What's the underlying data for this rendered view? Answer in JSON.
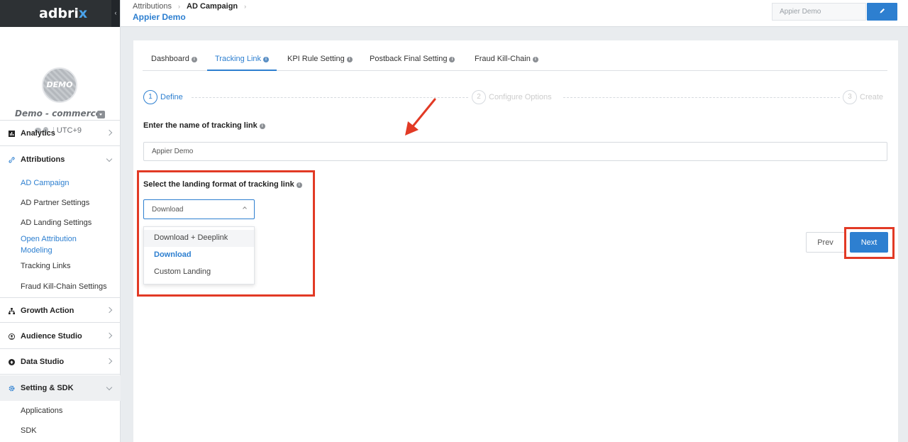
{
  "brand": {
    "logo_main": "adbri",
    "logo_accent": "x"
  },
  "profile": {
    "avatar_text": "DEMO",
    "org_name": "Demo - commerce",
    "timezone": "UTC+9"
  },
  "sidebar": {
    "sections": {
      "analytics": "Analytics",
      "attributions": "Attributions",
      "growth_action": "Growth Action",
      "audience_studio": "Audience Studio",
      "data_studio": "Data Studio",
      "setting_sdk": "Setting & SDK"
    },
    "attribution_items": [
      "AD Campaign",
      "AD Partner Settings",
      "AD Landing Settings",
      "Open Attribution",
      "Modeling",
      "Tracking Links",
      "Fraud Kill-Chain Settings"
    ],
    "setting_items": [
      "Applications",
      "SDK"
    ]
  },
  "header": {
    "breadcrumb": [
      "Attributions",
      "AD Campaign"
    ],
    "subtitle": "Appier Demo",
    "name_value": "Appier Demo"
  },
  "tabs": [
    "Dashboard",
    "Tracking Link",
    "KPI Rule Setting",
    "Postback Final Setting",
    "Fraud Kill-Chain"
  ],
  "steps": [
    {
      "num": "1",
      "label": "Define"
    },
    {
      "num": "2",
      "label": "Configure Options"
    },
    {
      "num": "3",
      "label": "Create"
    }
  ],
  "form": {
    "name_label": "Enter the name of tracking link",
    "name_value": "Appier Demo",
    "landing_label": "Select the landing format of tracking link",
    "landing_selected": "Download",
    "landing_options": [
      "Download + Deeplink",
      "Download",
      "Custom Landing"
    ]
  },
  "buttons": {
    "prev": "Prev",
    "next": "Next"
  },
  "colors": {
    "accent": "#2d7fd0",
    "annotation": "#e23a25",
    "sidebar_dark": "#2d3134"
  }
}
